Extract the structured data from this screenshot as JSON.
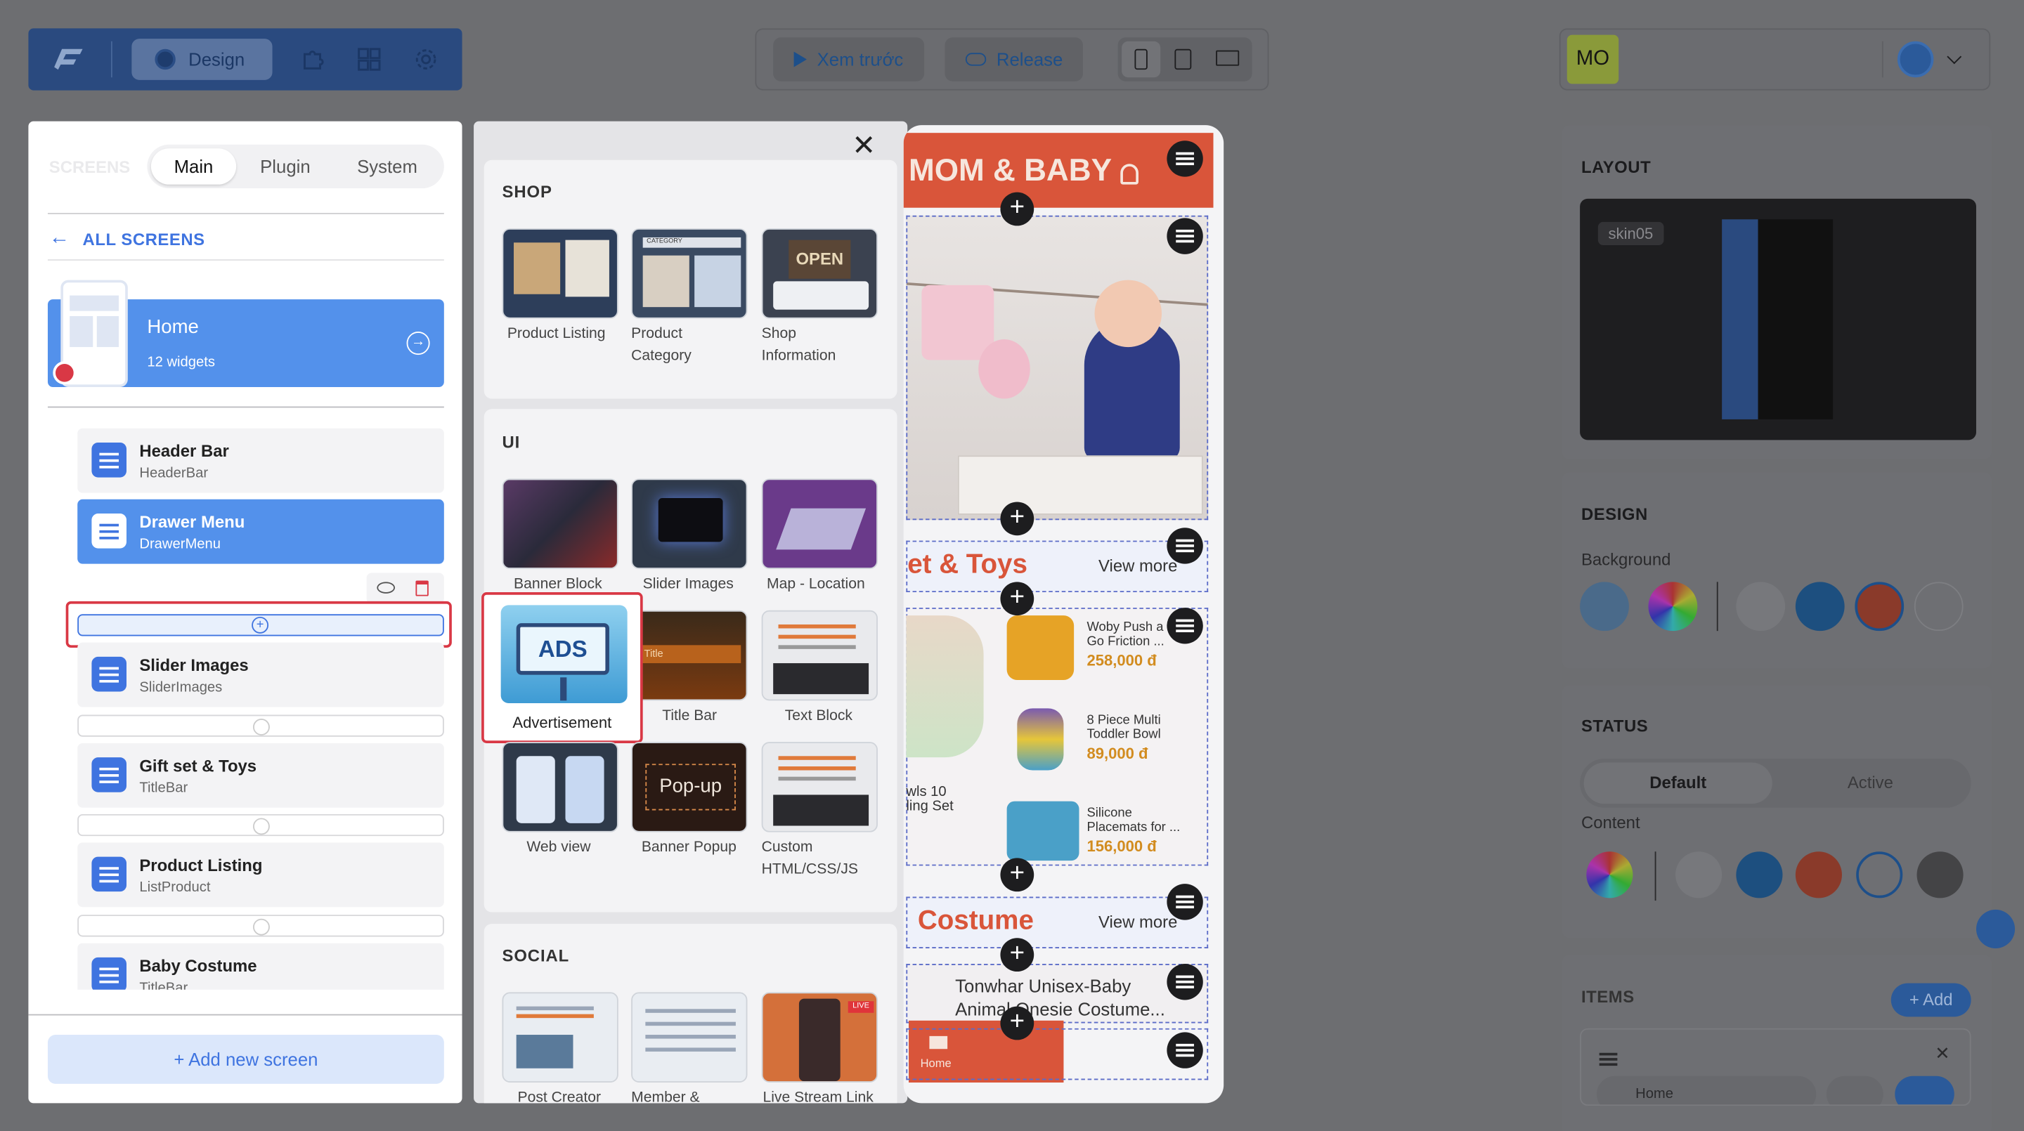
{
  "topbar": {
    "logo_icon": "app-logo",
    "design_label": "Design",
    "preview_label": "Xem trước",
    "release_label": "Release",
    "avatar_initials": "MO"
  },
  "screens_panel": {
    "heading": "SCREENS",
    "tabs": [
      {
        "label": "Main",
        "active": true
      },
      {
        "label": "Plugin",
        "active": false
      },
      {
        "label": "System",
        "active": false
      }
    ],
    "all_screens": "ALL SCREENS",
    "current_screen": {
      "name": "Home",
      "widgets": "12 widgets"
    },
    "widgets": [
      {
        "title": "Header Bar",
        "type": "HeaderBar"
      },
      {
        "title": "Drawer Menu",
        "type": "DrawerMenu"
      },
      {
        "title": "Slider Images",
        "type": "SliderImages"
      },
      {
        "title": "Gift set & Toys",
        "type": "TitleBar"
      },
      {
        "title": "Product Listing",
        "type": "ListProduct"
      },
      {
        "title": "Baby Costume",
        "type": "TitleBar"
      }
    ],
    "add_screen": "+ Add new screen"
  },
  "palette": {
    "sections": {
      "shop": "SHOP",
      "ui": "UI",
      "social": "SOCIAL"
    },
    "shop_items": [
      "Product Listing",
      "Product Category",
      "Shop Information"
    ],
    "ui_items": [
      "Banner Block",
      "Slider Images",
      "Map - Location",
      "Advertisement",
      "Title Bar",
      "Text Block",
      "Web view",
      "Banner Popup",
      "Custom HTML/CSS/JS"
    ],
    "social_items": [
      "Post Creator",
      "Member &",
      "Live Stream Link"
    ],
    "thumb_text": {
      "category": "CATEGORY",
      "open": "OPEN",
      "ads": "ADS",
      "title": "Title",
      "popup": "Pop-up",
      "live": "LIVE"
    }
  },
  "phone": {
    "brand": "MOM & BABY",
    "section1_title": "et & Toys",
    "section1_more": "View more",
    "products": [
      {
        "name": "Woby Push a Go Friction ...",
        "price": "258,000 đ"
      },
      {
        "name": "8 Piece Multi Toddler Bowl",
        "price": "89,000 đ"
      },
      {
        "name": "Silicone Placemats for ...",
        "price": "156,000 đ"
      }
    ],
    "side_product": "wls 10 ling Set",
    "section2_title": "Costume",
    "section2_more": "View more",
    "costume_name": "Tonwhar Unisex-Baby Animal Onesie Costume...",
    "nav_home": "Home"
  },
  "right_panel": {
    "layout_title": "LAYOUT",
    "skin_name": "skin05",
    "design_title": "DESIGN",
    "background_label": "Background",
    "status_title": "STATUS",
    "status_tabs": [
      "Default",
      "Active"
    ],
    "content_label": "Content",
    "items_title": "ITEMS",
    "add_label": "+ Add",
    "item_name": "Home"
  },
  "colors": {
    "accent_blue": "#5391eb",
    "highlight_red": "#d93845",
    "brand_orange": "#d9553a"
  }
}
